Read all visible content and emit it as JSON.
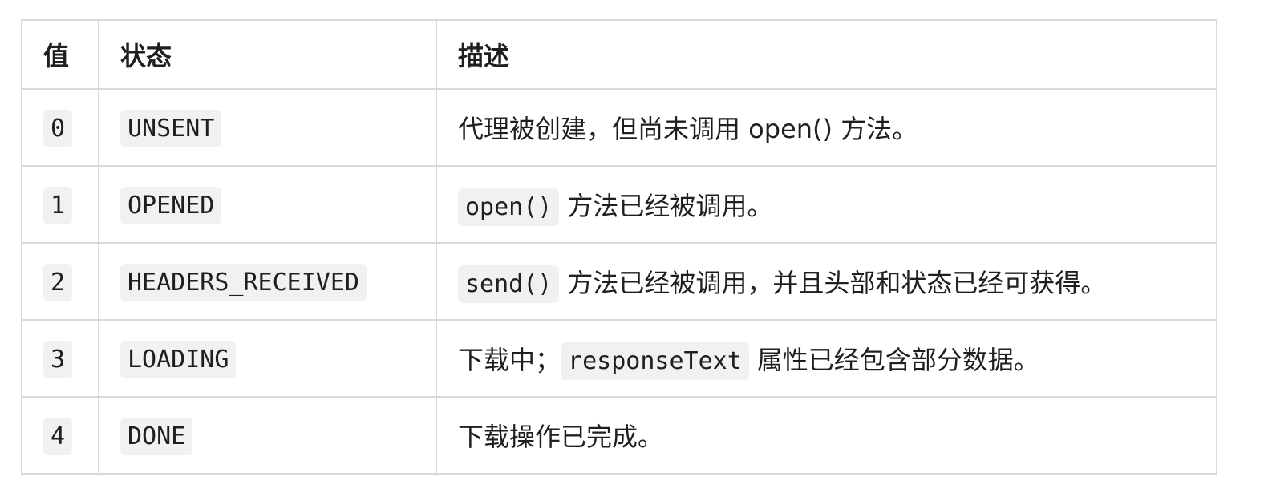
{
  "table": {
    "headers": [
      "值",
      "状态",
      "描述"
    ],
    "rows": [
      {
        "value": "0",
        "state": "UNSENT",
        "desc_pre": "",
        "desc_code": "",
        "desc_post": "代理被创建，但尚未调用 open() 方法。"
      },
      {
        "value": "1",
        "state": "OPENED",
        "desc_pre": "",
        "desc_code": "open()",
        "desc_post": "方法已经被调用。"
      },
      {
        "value": "2",
        "state": "HEADERS_RECEIVED",
        "desc_pre": "",
        "desc_code": "send()",
        "desc_post": "方法已经被调用，并且头部和状态已经可获得。"
      },
      {
        "value": "3",
        "state": "LOADING",
        "desc_pre": "下载中；",
        "desc_code": "responseText",
        "desc_post": "属性已经包含部分数据。"
      },
      {
        "value": "4",
        "state": "DONE",
        "desc_pre": "",
        "desc_code": "",
        "desc_post": "下载操作已完成。"
      }
    ]
  }
}
